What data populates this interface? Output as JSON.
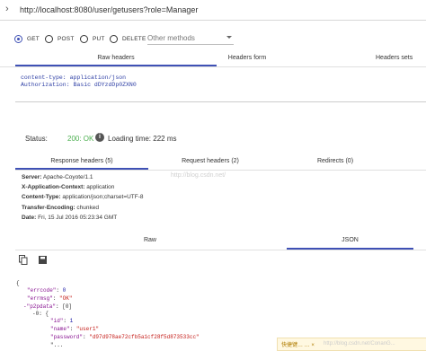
{
  "url": {
    "value": "http://localhost:8080/user/getusers?role=Manager"
  },
  "methods": [
    {
      "label": "GET",
      "selected": true
    },
    {
      "label": "POST",
      "selected": false
    },
    {
      "label": "PUT",
      "selected": false
    },
    {
      "label": "DELETE",
      "selected": false
    }
  ],
  "other_methods": {
    "label": "Other methods"
  },
  "header_tabs": [
    "Raw headers",
    "Headers form",
    "Headers sets"
  ],
  "raw_headers": {
    "line1": "content-type: application/json",
    "line2": "Authorization: Basic dDYzdDp0ZXN0"
  },
  "status": {
    "label": "Status:",
    "value": "200: OK",
    "loading_time": "Loading time: 222 ms"
  },
  "response_tabs": [
    "Response headers (5)",
    "Request headers (2)",
    "Redirects (0)"
  ],
  "response_headers": [
    {
      "name": "Server:",
      "value": "Apache-Coyote/1.1"
    },
    {
      "name": "X-Application-Context:",
      "value": "application"
    },
    {
      "name": "Content-Type:",
      "value": "application/json;charset=UTF-8"
    },
    {
      "name": "Transfer-Encoding:",
      "value": "chunked"
    },
    {
      "name": "Date:",
      "value": "Fri, 15 Jul 2016 05:23:34 GMT"
    }
  ],
  "body_tabs": [
    "Raw",
    "JSON"
  ],
  "json_view": {
    "open": "{",
    "errcode": {
      "key": "\"errcode\"",
      "value": "0"
    },
    "errmsg": {
      "key": "\"errmsg\"",
      "value": "\"OK\""
    },
    "p2pdata": {
      "key": "-\"p2pdata\"",
      "value": "[0]"
    },
    "item0": "-0: {",
    "id": {
      "key": "\"id\"",
      "value": "1"
    },
    "name": {
      "key": "\"name\"",
      "value": "\"user1\""
    },
    "password": {
      "key": "\"password\"",
      "value": "\"d97d978ae72cfb5a1cf28f5d873533cc\""
    },
    "trunc": "\"..."
  },
  "watermark": "http://blog.csdn.net/",
  "watermark2": "http://blog.csdn.net/ConanG...",
  "toast": "快捷键…  … ×",
  "colors": {
    "accent": "#3f51b5",
    "ok": "#4caf50"
  }
}
